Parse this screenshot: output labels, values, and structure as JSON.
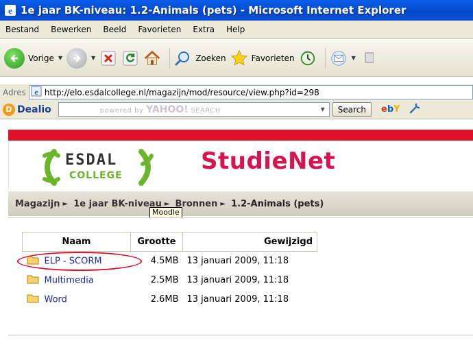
{
  "window": {
    "title": "1e jaar BK-niveau: 1.2-Animals (pets) - Microsoft Internet Explorer"
  },
  "menu": {
    "items": [
      "Bestand",
      "Bewerken",
      "Beeld",
      "Favorieten",
      "Extra",
      "Help"
    ]
  },
  "toolbar": {
    "back_label": "Vorige",
    "search_label": "Zoeken",
    "favorites_label": "Favorieten"
  },
  "address": {
    "label": "Adres",
    "url": "http://elo.esdalcollege.nl/magazijn/mod/resource/view.php?id=298"
  },
  "dealio": {
    "brand": "Dealio",
    "powered_by": "powered by",
    "yahoo": "YAHOO!",
    "search_text": "SEARCH",
    "search_button": "Search",
    "ebay": "ebY"
  },
  "site": {
    "logo_line1": "ESDAL",
    "logo_line2": "COLLEGE",
    "name": "StudieNet"
  },
  "breadcrumb": {
    "items": [
      "Magazijn",
      "1e jaar BK-niveau",
      "Bronnen"
    ],
    "current": "1.2-Animals (pets)",
    "tooltip": "Moodle"
  },
  "files": {
    "headers": {
      "name": "Naam",
      "size": "Grootte",
      "modified": "Gewijzigd"
    },
    "rows": [
      {
        "name": "ELP - SCORM",
        "size": "4.5MB",
        "modified": "13 januari 2009, 11:18"
      },
      {
        "name": "Multimedia",
        "size": "2.5MB",
        "modified": "13 januari 2009, 11:18"
      },
      {
        "name": "Word",
        "size": "2.6MB",
        "modified": "13 januari 2009, 11:18"
      }
    ]
  },
  "colors": {
    "title_bar": "#0349c8",
    "site_red": "#e0102c",
    "studienet_pink": "#d6144f",
    "esdal_green": "#6bb52c",
    "link_blue": "#1a2a9e"
  }
}
